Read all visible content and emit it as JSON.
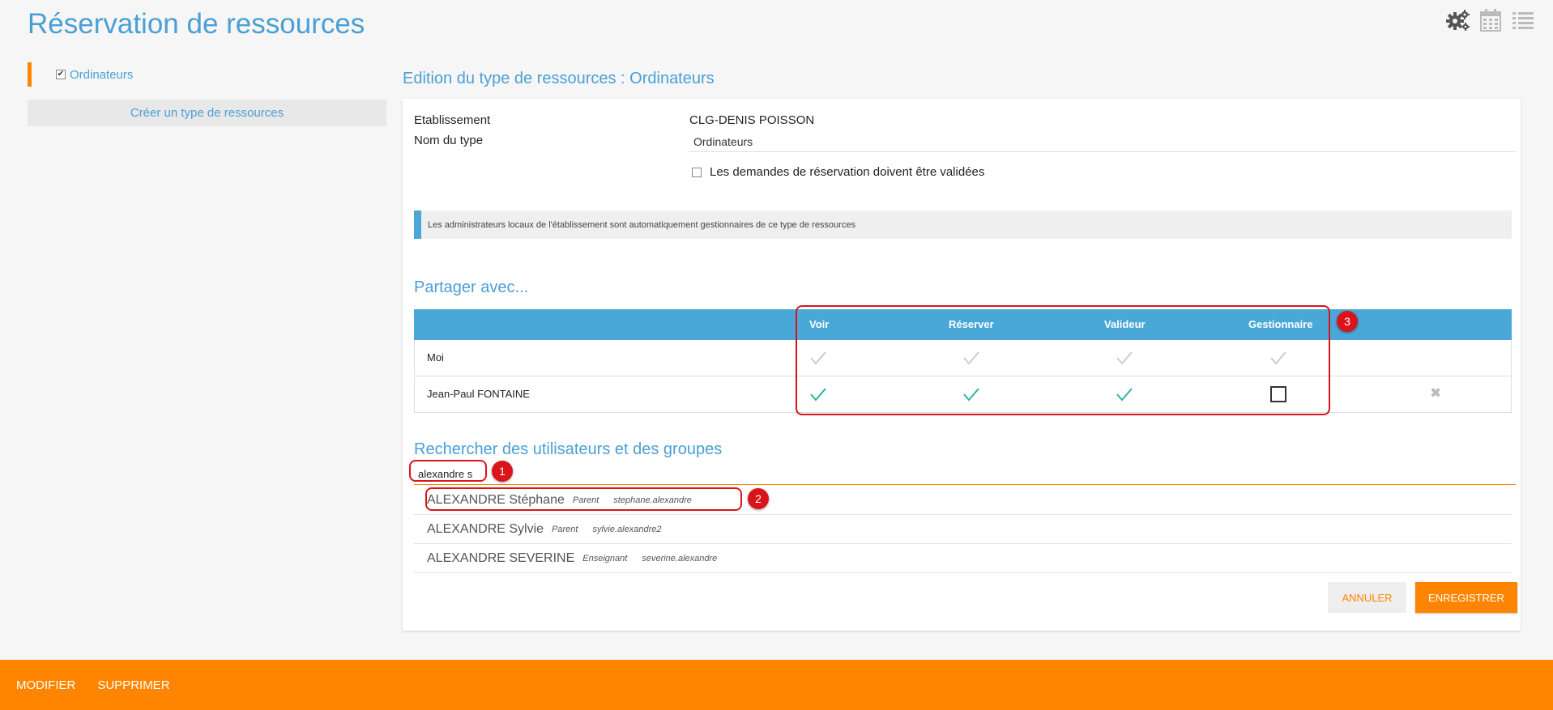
{
  "page": {
    "title": "Réservation de ressources",
    "top_icons": [
      "gears-icon",
      "calendar-icon",
      "list-icon"
    ]
  },
  "sidebar": {
    "items": [
      {
        "label": "Ordinateurs",
        "checked": true
      }
    ],
    "create_label": "Créer un type de ressources"
  },
  "edition": {
    "title": "Edition du type de ressources : Ordinateurs",
    "establishment_label": "Etablissement",
    "establishment_value": "CLG-DENIS POISSON",
    "type_name_label": "Nom du type",
    "type_name_value": "Ordinateurs",
    "validation_label": "Les demandes de réservation doivent être validées",
    "validation_checked": false,
    "info_text": "Les administrateurs locaux de l'établissement sont automatiquement gestionnaires de ce type de ressources"
  },
  "share": {
    "title": "Partager avec...",
    "columns": [
      "Voir",
      "Réserver",
      "Valideur",
      "Gestionnaire"
    ],
    "rows": [
      {
        "name": "Moi",
        "rights": [
          "check-disabled",
          "check-disabled",
          "check-disabled",
          "check-disabled"
        ],
        "removable": false
      },
      {
        "name": "Jean-Paul FONTAINE",
        "rights": [
          "check",
          "check",
          "check",
          "empty"
        ],
        "removable": true
      }
    ]
  },
  "search": {
    "title": "Rechercher des utilisateurs et des groupes",
    "value": "alexandre s",
    "results": [
      {
        "name": "ALEXANDRE Stéphane",
        "profile": "Parent",
        "login": "stephane.alexandre"
      },
      {
        "name": "ALEXANDRE Sylvie",
        "profile": "Parent",
        "login": "sylvie.alexandre2"
      },
      {
        "name": "ALEXANDRE SEVERINE",
        "profile": "Enseignant",
        "login": "severine.alexandre"
      }
    ]
  },
  "actions": {
    "cancel": "ANNULER",
    "save": "ENREGISTRER"
  },
  "annotations": [
    "1",
    "2",
    "3"
  ],
  "footer": {
    "modify": "MODIFIER",
    "delete": "SUPPRIMER"
  },
  "colors": {
    "accent_blue": "#4a9fd5",
    "table_header": "#4aa8d8",
    "orange": "#ff8500",
    "check_green": "#2bb5a0",
    "annotation_red": "#d9141b"
  }
}
